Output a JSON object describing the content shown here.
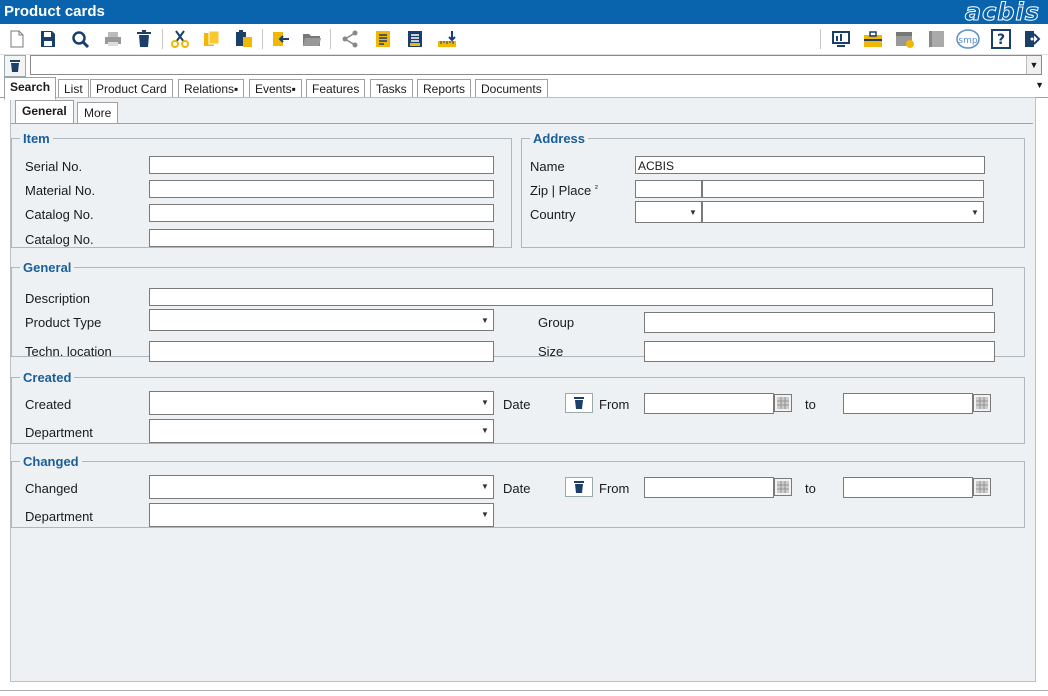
{
  "window": {
    "title": "Product cards",
    "logo": "acbis"
  },
  "toolbar": {
    "left_icons": [
      "new-document-icon",
      "save-icon",
      "search-icon",
      "print-icon",
      "delete-icon",
      "cut-icon",
      "copy-icon",
      "paste-icon",
      "import-icon",
      "folder-open-icon",
      "share-icon",
      "report-icon",
      "list-report-icon",
      "measure-icon"
    ],
    "right_icons": [
      "monitor-icon",
      "briefcase-icon",
      "calendar-settings-icon",
      "book-icon",
      "smp-icon",
      "help-icon",
      "exit-icon"
    ],
    "smp_label": "smp",
    "help_label": "?"
  },
  "filter": {
    "value": ""
  },
  "tabs": [
    "Search",
    "List",
    "Product Card",
    "Relations▪",
    "Events▪",
    "Features",
    "Tasks",
    "Reports",
    "Documents"
  ],
  "active_tab": "Search",
  "subtabs": [
    "General",
    "More"
  ],
  "item": {
    "legend": "Item",
    "serial_no_label": "Serial No.",
    "material_no_label": "Material No.",
    "catalog_no_label": "Catalog No.",
    "catalog_no2_label": "Catalog No.",
    "serial_no": "",
    "material_no": "",
    "catalog_no": "",
    "catalog_no2": ""
  },
  "address": {
    "legend": "Address",
    "name_label": "Name",
    "name_value": "ACBIS",
    "zip_label": "Zip | Place",
    "zip_marker": "²",
    "country_label": "Country",
    "zip": "",
    "place": "",
    "country_code": "",
    "country": ""
  },
  "general": {
    "legend": "General",
    "description_label": "Description",
    "product_type_label": "Product Type",
    "techn_location_label": "Techn. location",
    "group_label": "Group",
    "size_label": "Size"
  },
  "created": {
    "legend": "Created",
    "created_label": "Created",
    "department_label": "Department",
    "date_label": "Date",
    "from_label": "From",
    "to_label": "to"
  },
  "changed": {
    "legend": "Changed",
    "changed_label": "Changed",
    "department_label": "Department",
    "date_label": "Date",
    "from_label": "From",
    "to_label": "to"
  },
  "colors": {
    "accent": "#0a64ad",
    "legend": "#1a5e98",
    "panel": "#eef1f4",
    "icon_yellow": "#f2b705",
    "icon_navy": "#1b3f6b"
  }
}
